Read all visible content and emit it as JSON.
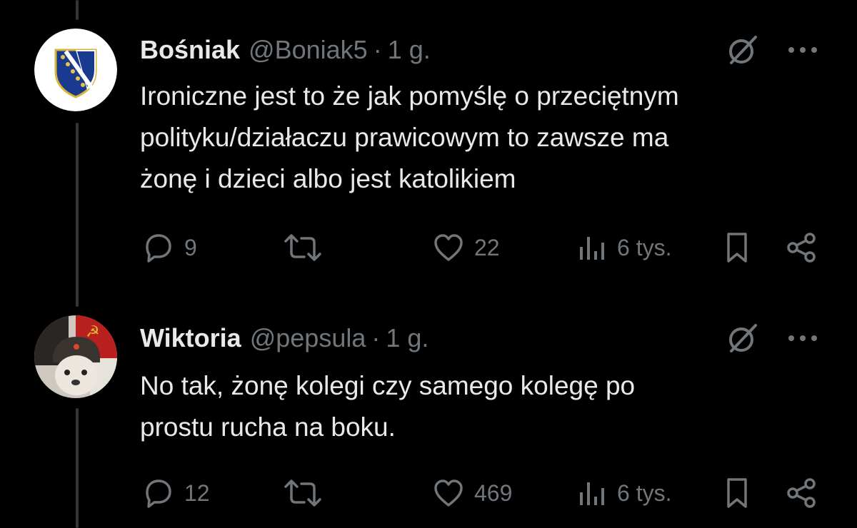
{
  "tweets": [
    {
      "name": "Bośniak",
      "handle": "@Boniak5",
      "separator": "·",
      "time": "1 g.",
      "text_lines": [
        "Ironiczne jest to że jak pomyślę o przeciętnym",
        "polityku/działaczu prawicowym to zawsze ma",
        "żonę i dzieci albo jest katolikiem"
      ],
      "replies": "9",
      "likes": "22",
      "views": "6 tys.",
      "avatar_icon": "bosnian-coat-of-arms-icon"
    },
    {
      "name": "Wiktoria",
      "handle": "@pepsula",
      "separator": "·",
      "time": "1 g.",
      "text_lines": [
        "No tak, żonę kolegi czy samego kolegę po",
        "prostu rucha na boku."
      ],
      "replies": "12",
      "likes": "469",
      "views": "6 tys.",
      "avatar_icon": "dog-with-ushanka-photo-icon"
    }
  ],
  "colors": {
    "background": "#000000",
    "text": "#e7e9ea",
    "muted": "#71767b",
    "thread_line": "#333639"
  }
}
